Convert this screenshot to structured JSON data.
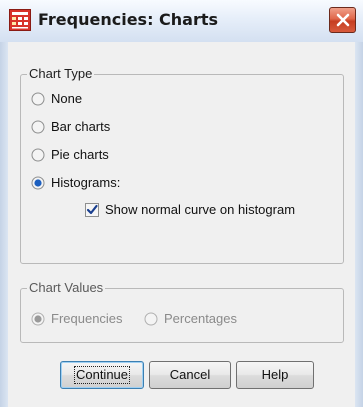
{
  "window": {
    "title": "Frequencies: Charts"
  },
  "chart_type": {
    "legend": "Chart Type",
    "options": [
      {
        "label": "None",
        "selected": false
      },
      {
        "label": "Bar charts",
        "selected": false
      },
      {
        "label": "Pie charts",
        "selected": false
      },
      {
        "label": "Histograms:",
        "selected": true
      }
    ],
    "normal_curve": {
      "label": "Show normal curve on histogram",
      "checked": true
    }
  },
  "chart_values": {
    "legend": "Chart Values",
    "options": [
      {
        "label": "Frequencies",
        "selected": true,
        "enabled": false
      },
      {
        "label": "Percentages",
        "selected": false,
        "enabled": false
      }
    ]
  },
  "buttons": {
    "continue": "Continue",
    "cancel": "Cancel",
    "help": "Help"
  },
  "icons": {
    "app": "spss-table-icon",
    "close": "close-icon"
  },
  "colors": {
    "close": "#d04a2c",
    "accent": "#1c5fbf",
    "check": "#1a3f8f"
  }
}
